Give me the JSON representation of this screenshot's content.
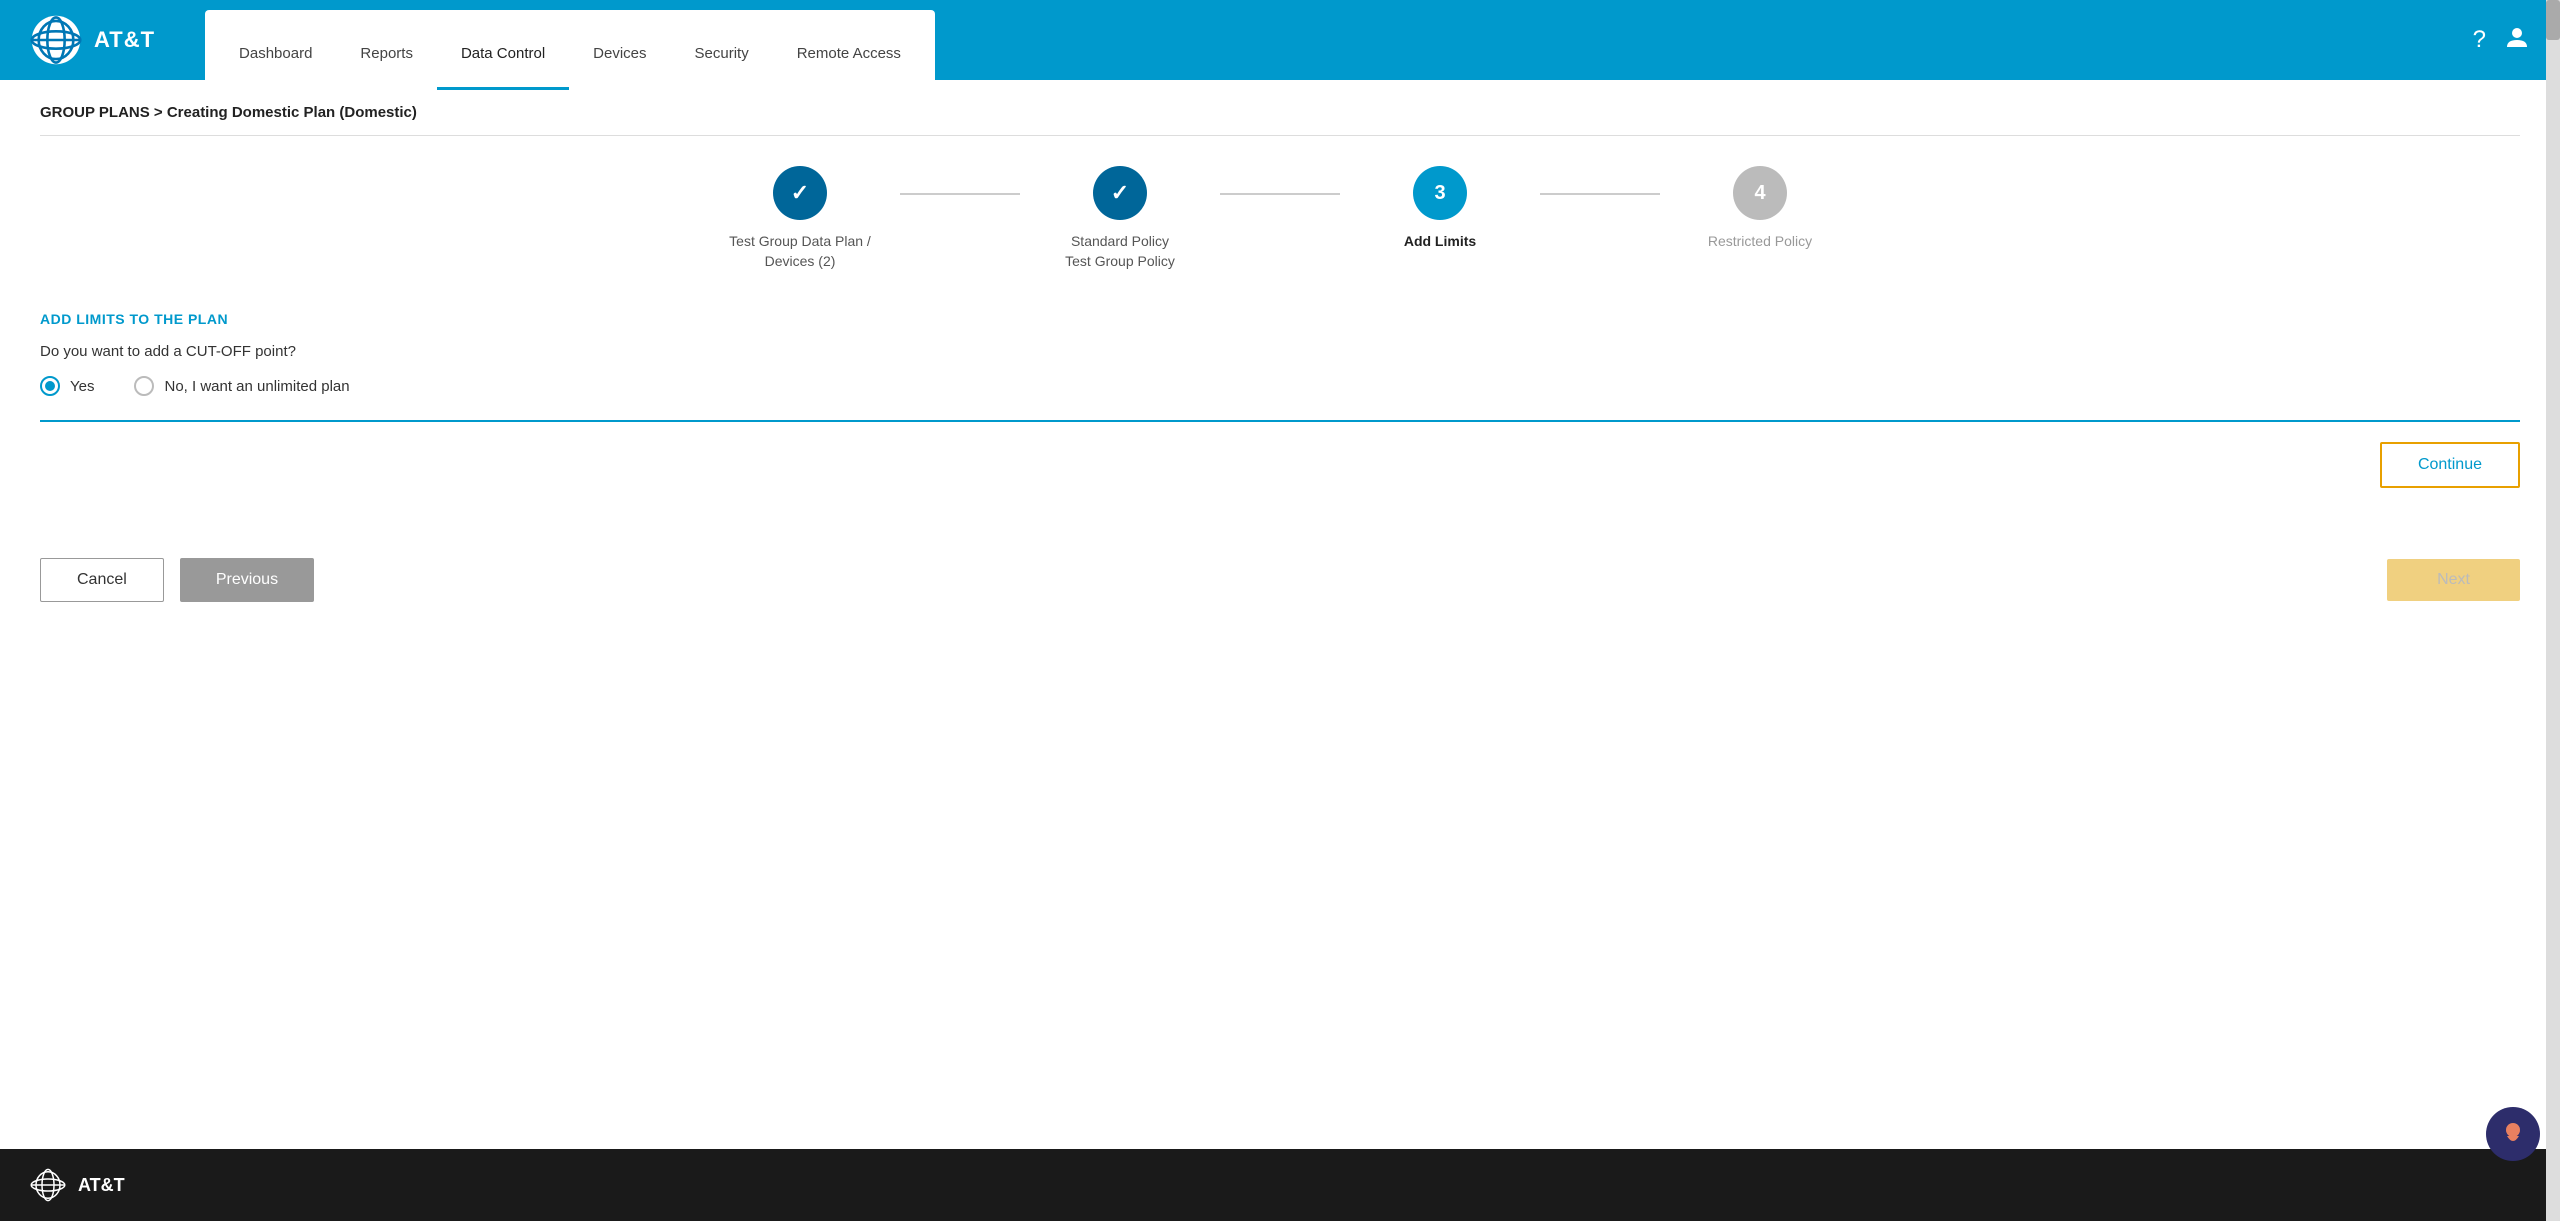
{
  "header": {
    "logo_text": "AT&T",
    "help_icon": "?",
    "user_icon": "👤",
    "nav_items": [
      {
        "label": "Dashboard",
        "active": false
      },
      {
        "label": "Reports",
        "active": false
      },
      {
        "label": "Data Control",
        "active": true
      },
      {
        "label": "Devices",
        "active": false
      },
      {
        "label": "Security",
        "active": false
      },
      {
        "label": "Remote Access",
        "active": false
      }
    ]
  },
  "breadcrumb": "GROUP PLANS > Creating Domestic Plan (Domestic)",
  "stepper": {
    "steps": [
      {
        "number": "✓",
        "label": "Test Group Data Plan /\nDevices (2)",
        "state": "completed"
      },
      {
        "number": "✓",
        "label": "Standard Policy\nTest Group Policy",
        "state": "completed"
      },
      {
        "number": "3",
        "label": "Add Limits",
        "state": "active"
      },
      {
        "number": "4",
        "label": "Restricted Policy",
        "state": "inactive"
      }
    ]
  },
  "form": {
    "section_title": "ADD LIMITS TO THE PLAN",
    "question": "Do you want to add a CUT-OFF point?",
    "options": [
      {
        "label": "Yes",
        "selected": true
      },
      {
        "label": "No, I want an unlimited plan",
        "selected": false
      }
    ],
    "continue_label": "Continue"
  },
  "buttons": {
    "cancel_label": "Cancel",
    "previous_label": "Previous",
    "next_label": "Next"
  },
  "footer": {
    "logo_text": "AT&T"
  }
}
